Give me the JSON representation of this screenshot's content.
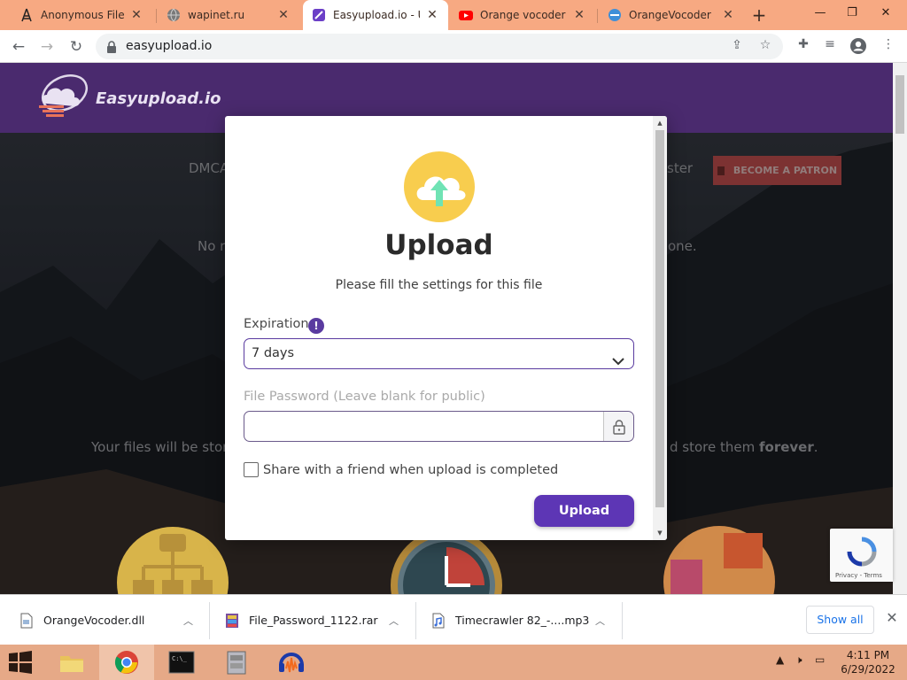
{
  "browser": {
    "tabs": [
      {
        "title": "Anonymous File Up",
        "icon": "tower-icon",
        "active": false
      },
      {
        "title": "wapinet.ru",
        "icon": "globe-icon",
        "active": false
      },
      {
        "title": "Easyupload.io - Up",
        "icon": "easyupload-favicon",
        "active": true
      },
      {
        "title": "Orange vocoder te",
        "icon": "youtube-icon",
        "active": false
      },
      {
        "title": "OrangeVocoder",
        "icon": "orange-vocoder-favicon",
        "active": false
      }
    ],
    "new_tab_label": "+",
    "url": "easyupload.io",
    "colors": {
      "tabstrip": "#f7a982",
      "accent": "#5d36b5"
    }
  },
  "site": {
    "logo_text": "Easyupload.io",
    "nav_left": "DMCA",
    "nav_right": "ster",
    "patron_label": "BECOME A PATRON",
    "bg_text_left": "No r",
    "bg_text_right": "one.",
    "bottom_text_left": "Your files will be store",
    "bottom_text_right": "d store them ",
    "bottom_text_bold": "forever",
    "bottom_text_end": "."
  },
  "modal": {
    "title": "Upload",
    "subtitle": "Please fill the settings for this file",
    "expiration_label": "Expiration",
    "expiration_value": "7 days",
    "password_label": "File Password (Leave blank for public)",
    "password_value": "",
    "share_label": "Share with a friend when upload is completed",
    "share_checked": false,
    "upload_button": "Upload"
  },
  "recaptcha": {
    "footer": "Privacy - Terms"
  },
  "downloads": {
    "items": [
      {
        "name": "OrangeVocoder.dll"
      },
      {
        "name": "File_Password_1122.rar"
      },
      {
        "name": "Timecrawler 82_-....mp3"
      }
    ],
    "show_all": "Show all"
  },
  "taskbar": {
    "time": "4:11 PM",
    "date": "6/29/2022"
  }
}
